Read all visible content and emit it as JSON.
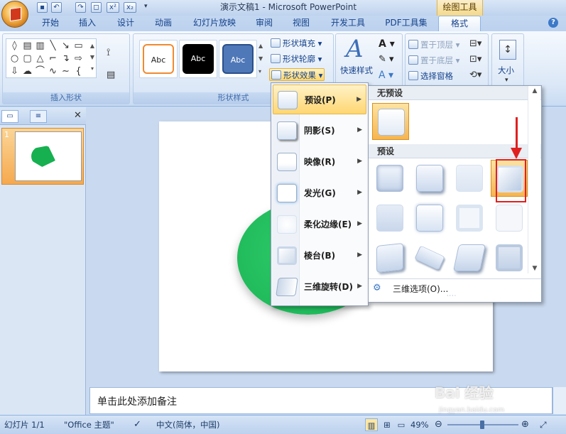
{
  "window": {
    "title": "演示文稿1 - Microsoft PowerPoint",
    "context_tab_group": "绘图工具"
  },
  "quick_access": {
    "undo_label": "↶",
    "redo_label": "↷",
    "x1_label": "x²",
    "x2_label": "x₂"
  },
  "tabs": [
    "开始",
    "插入",
    "设计",
    "动画",
    "幻灯片放映",
    "审阅",
    "视图",
    "开发工具",
    "PDF工具集",
    "格式"
  ],
  "active_tab": "格式",
  "help_label": "?",
  "ribbon": {
    "insert_shapes_group": "插入形状",
    "shape_styles_group": "形状样式",
    "style_samples": [
      "Abc",
      "Abc",
      "Abc"
    ],
    "shape_fill": "形状填充",
    "shape_outline": "形状轮廓",
    "shape_effects": "形状效果",
    "quick_styles": "快速样式",
    "bring_to_front": "置于顶层",
    "send_to_back": "置于底层",
    "selection_pane": "选择窗格",
    "size": "大小"
  },
  "panel": {
    "slide_number": "1",
    "close_label": "✕"
  },
  "notes_placeholder": "单击此处添加备注",
  "statusbar": {
    "slide_counter": "幻灯片 1/1",
    "theme": "\"Office 主题\"",
    "language": "中文(简体，中国)",
    "zoom": "49%"
  },
  "effects_menu": {
    "items": [
      {
        "label": "预设(P)",
        "hover": true
      },
      {
        "label": "阴影(S)"
      },
      {
        "label": "映像(R)"
      },
      {
        "label": "发光(G)"
      },
      {
        "label": "柔化边缘(E)"
      },
      {
        "label": "棱台(B)"
      },
      {
        "label": "三维旋转(D)"
      }
    ]
  },
  "preset_gallery": {
    "no_preset_header": "无预设",
    "preset_header": "预设",
    "more_options": "三维选项(O)...",
    "selected_index": 3
  },
  "watermark": {
    "text": "Bai 经验",
    "url": "jingyan.baidu.com"
  },
  "colors": {
    "ellipse": "#16b050",
    "highlight": "#ffd672",
    "annotation": "#e02020"
  }
}
